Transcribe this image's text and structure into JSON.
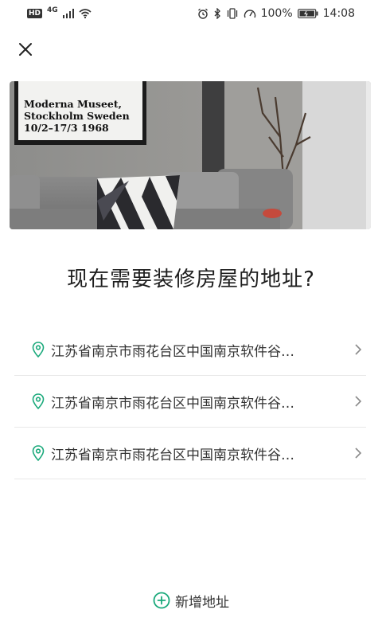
{
  "status_bar": {
    "hd": "HD",
    "network": "4G",
    "battery": "100%",
    "time": "14:08"
  },
  "header": {
    "close_icon": "close-icon"
  },
  "hero": {
    "poster_lines": [
      "Moderna Museet,",
      "Stockholm Sweden",
      "10/2–17/3 1968"
    ]
  },
  "main": {
    "question": "现在需要装修房屋的地址?",
    "addresses": [
      {
        "text": "江苏省南京市雨花台区中国南京软件谷…"
      },
      {
        "text": "江苏省南京市雨花台区中国南京软件谷…"
      },
      {
        "text": "江苏省南京市雨花台区中国南京软件谷…"
      }
    ],
    "add_label": "新增地址"
  },
  "colors": {
    "accent": "#1aa97b",
    "divider": "#e8e8e8",
    "chevron": "#8a8a8a"
  }
}
